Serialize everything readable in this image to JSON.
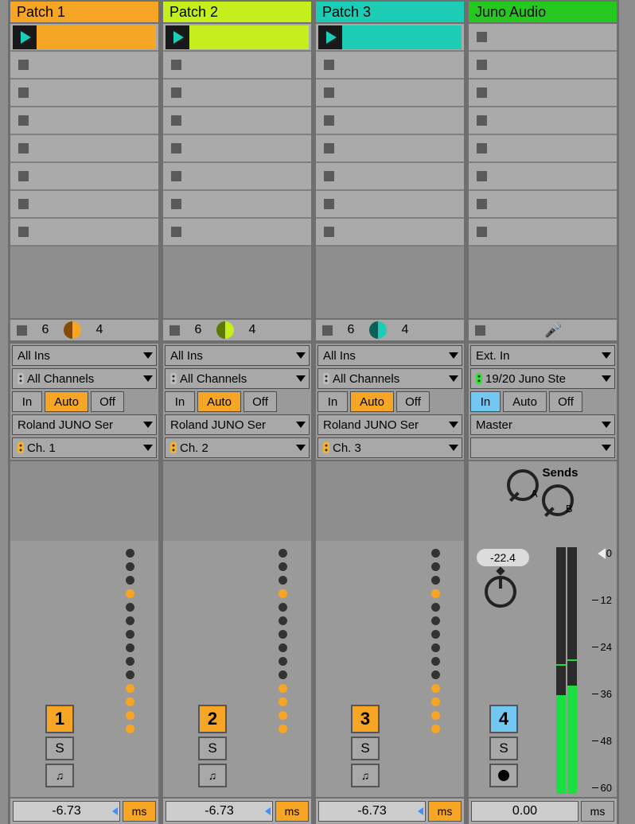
{
  "tracks": [
    {
      "name": "Patch 1",
      "color": "orange",
      "status": {
        "a": "6",
        "b": "4"
      },
      "io": {
        "input_type": "All Ins",
        "input_chan": "All Channels",
        "monitor_in": "In",
        "monitor_auto": "Auto",
        "monitor_off": "Off",
        "monitor_active": "auto",
        "output_type": "Roland JUNO Ser",
        "output_chan": "Ch. 1"
      },
      "mixer": {
        "num": "1",
        "solo": "S"
      },
      "delay": {
        "value": "-6.73",
        "unit": "ms"
      }
    },
    {
      "name": "Patch 2",
      "color": "lime",
      "status": {
        "a": "6",
        "b": "4"
      },
      "io": {
        "input_type": "All Ins",
        "input_chan": "All Channels",
        "monitor_in": "In",
        "monitor_auto": "Auto",
        "monitor_off": "Off",
        "monitor_active": "auto",
        "output_type": "Roland JUNO Ser",
        "output_chan": "Ch. 2"
      },
      "mixer": {
        "num": "2",
        "solo": "S"
      },
      "delay": {
        "value": "-6.73",
        "unit": "ms"
      }
    },
    {
      "name": "Patch 3",
      "color": "teal",
      "status": {
        "a": "6",
        "b": "4"
      },
      "io": {
        "input_type": "All Ins",
        "input_chan": "All Channels",
        "monitor_in": "In",
        "monitor_auto": "Auto",
        "monitor_off": "Off",
        "monitor_active": "auto",
        "output_type": "Roland JUNO Ser",
        "output_chan": "Ch. 3"
      },
      "mixer": {
        "num": "3",
        "solo": "S"
      },
      "delay": {
        "value": "-6.73",
        "unit": "ms"
      }
    },
    {
      "name": "Juno Audio",
      "color": "green",
      "is_audio": true,
      "io": {
        "input_type": "Ext. In",
        "input_chan": "19/20 Juno Ste",
        "monitor_in": "In",
        "monitor_auto": "Auto",
        "monitor_off": "Off",
        "monitor_active": "in",
        "output_type": "Master",
        "output_chan": ""
      },
      "sends": {
        "label": "Sends",
        "a": "A",
        "b": "B"
      },
      "mixer": {
        "num": "4",
        "solo": "S",
        "db": "-22.4"
      },
      "scale": [
        "0",
        "12",
        "24",
        "36",
        "48",
        "60"
      ],
      "delay": {
        "value": "0.00",
        "unit": "ms"
      }
    }
  ]
}
